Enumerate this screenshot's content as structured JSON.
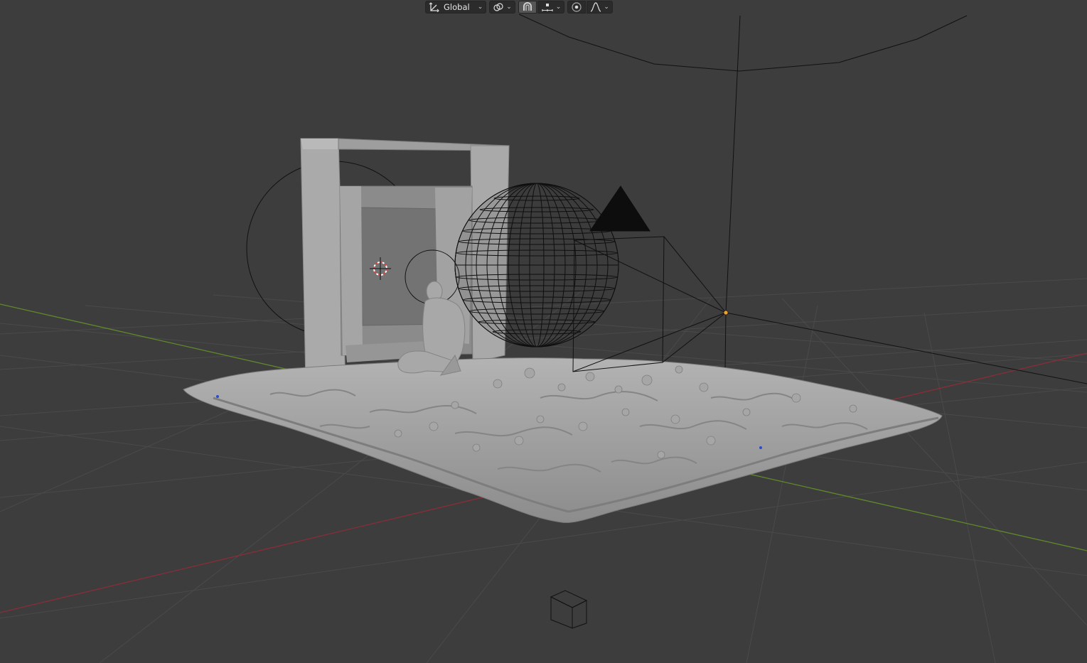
{
  "header": {
    "transform_orientation": {
      "label": "Global",
      "icon": "transform-orientation-icon"
    },
    "pivot_icon": "pivot-point-icon",
    "snap_icon": "snap-magnet-icon",
    "snap_target_icon": "snap-increment-icon",
    "proportional_icon": "proportional-editing-icon",
    "falloff_icon": "falloff-curve-icon"
  },
  "colors": {
    "background": "#3d3d3d",
    "grid": "#4a4a4a",
    "x_axis": "#8a2d3a",
    "y_axis": "#5f8a2a",
    "mesh": "#9a9a9a",
    "wire": "#000000",
    "light_origin": "#f0a030"
  }
}
